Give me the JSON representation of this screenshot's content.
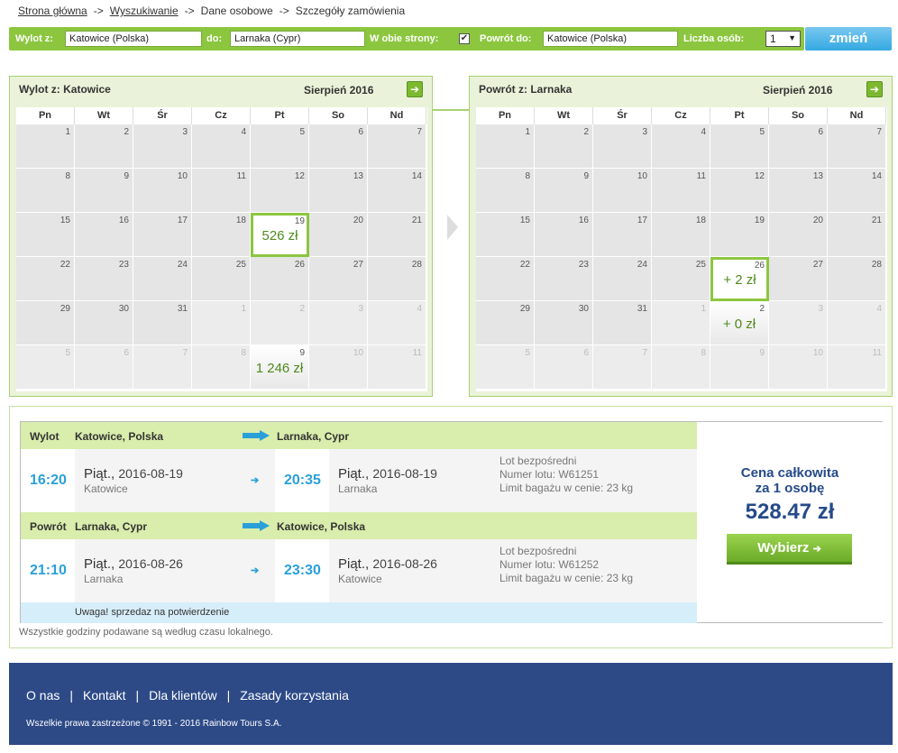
{
  "breadcrumb": {
    "items": [
      "Strona główna",
      "Wyszukiwanie",
      "Dane osobowe",
      "Szczegóły zamówienia"
    ],
    "separator": "->"
  },
  "search": {
    "from_label": "Wylot z:",
    "from_value": "Katowice (Polska)",
    "to_label": "do:",
    "to_value": "Larnaka (Cypr)",
    "roundtrip_label": "W obie strony:",
    "roundtrip_checked": true,
    "return_label": "Powrót do:",
    "return_value": "Katowice (Polska)",
    "persons_label": "Liczba osób:",
    "persons_value": "1",
    "submit_label": "zmień"
  },
  "weekdays": [
    "Pn",
    "Wt",
    "Śr",
    "Cz",
    "Pt",
    "So",
    "Nd"
  ],
  "outbound_calendar": {
    "title": "Wylot z: Katowice",
    "month": "Sierpień 2016",
    "days": [
      "1",
      "2",
      "3",
      "4",
      "5",
      "6",
      "7",
      "8",
      "9",
      "10",
      "11",
      "12",
      "13",
      "14",
      "15",
      "16",
      "17",
      "18",
      "19",
      "20",
      "21",
      "22",
      "23",
      "24",
      "25",
      "26",
      "27",
      "28",
      "29",
      "30",
      "31",
      "1",
      "2",
      "3",
      "4",
      "5",
      "6",
      "7",
      "8",
      "9",
      "10",
      "11"
    ],
    "selected_day": "19",
    "prices": [
      {
        "day": "19",
        "price": "526 zł"
      },
      {
        "day": "9",
        "price": "1 246 zł"
      }
    ]
  },
  "return_calendar": {
    "title": "Powrót z: Larnaka",
    "month": "Sierpień 2016",
    "days": [
      "1",
      "2",
      "3",
      "4",
      "5",
      "6",
      "7",
      "8",
      "9",
      "10",
      "11",
      "12",
      "13",
      "14",
      "15",
      "16",
      "17",
      "18",
      "19",
      "20",
      "21",
      "22",
      "23",
      "24",
      "25",
      "26",
      "27",
      "28",
      "29",
      "30",
      "31",
      "1",
      "2",
      "3",
      "4",
      "5",
      "6",
      "7",
      "8",
      "9",
      "10",
      "11"
    ],
    "selected_day": "26",
    "prices": [
      {
        "day": "26",
        "price": "+ 2 zł"
      },
      {
        "day": "2",
        "price": "+ 0 zł"
      }
    ]
  },
  "outbound": {
    "label": "Wylot",
    "from": "Katowice, Polska",
    "to": "Larnaka, Cypr",
    "dep_time": "16:20",
    "dep_day": "Piąt.,",
    "dep_date": "2016-08-19",
    "dep_city": "Katowice",
    "arr_time": "20:35",
    "arr_day": "Piąt.,",
    "arr_date": "2016-08-19",
    "arr_city": "Larnaka",
    "info1": "Lot bezpośredni",
    "info2": "Numer lotu: W61251",
    "info3": "Limit bagażu w cenie: 23 kg"
  },
  "return": {
    "label": "Powrót",
    "from": "Larnaka, Cypr",
    "to": "Katowice, Polska",
    "dep_time": "21:10",
    "dep_day": "Piąt.,",
    "dep_date": "2016-08-26",
    "dep_city": "Larnaka",
    "arr_time": "23:30",
    "arr_day": "Piąt.,",
    "arr_date": "2016-08-26",
    "arr_city": "Katowice",
    "info1": "Lot bezpośredni",
    "info2": "Numer lotu: W61252",
    "info3": "Limit bagażu w cenie: 23 kg"
  },
  "warning": "Uwaga! sprzedaz na potwierdzenie",
  "price": {
    "label_line1": "Cena całkowita",
    "label_line2": "za 1 osobę",
    "value": "528.47 zł",
    "button": "Wybierz"
  },
  "note": "Wszystkie godziny podawane są według czasu lokalnego.",
  "footer": {
    "links": [
      "O nas",
      "Kontakt",
      "Dla klientów",
      "Zasady korzystania"
    ],
    "copyright": "Wszelkie prawa zastrzeżone © 1991 - 2016 Rainbow Tours S.A."
  },
  "colors": {
    "accent_green": "#8cc63f",
    "price_green": "#4e8a1d",
    "blue": "#2aa0d8",
    "navy": "#264a8a",
    "footer": "#2d4a87"
  }
}
